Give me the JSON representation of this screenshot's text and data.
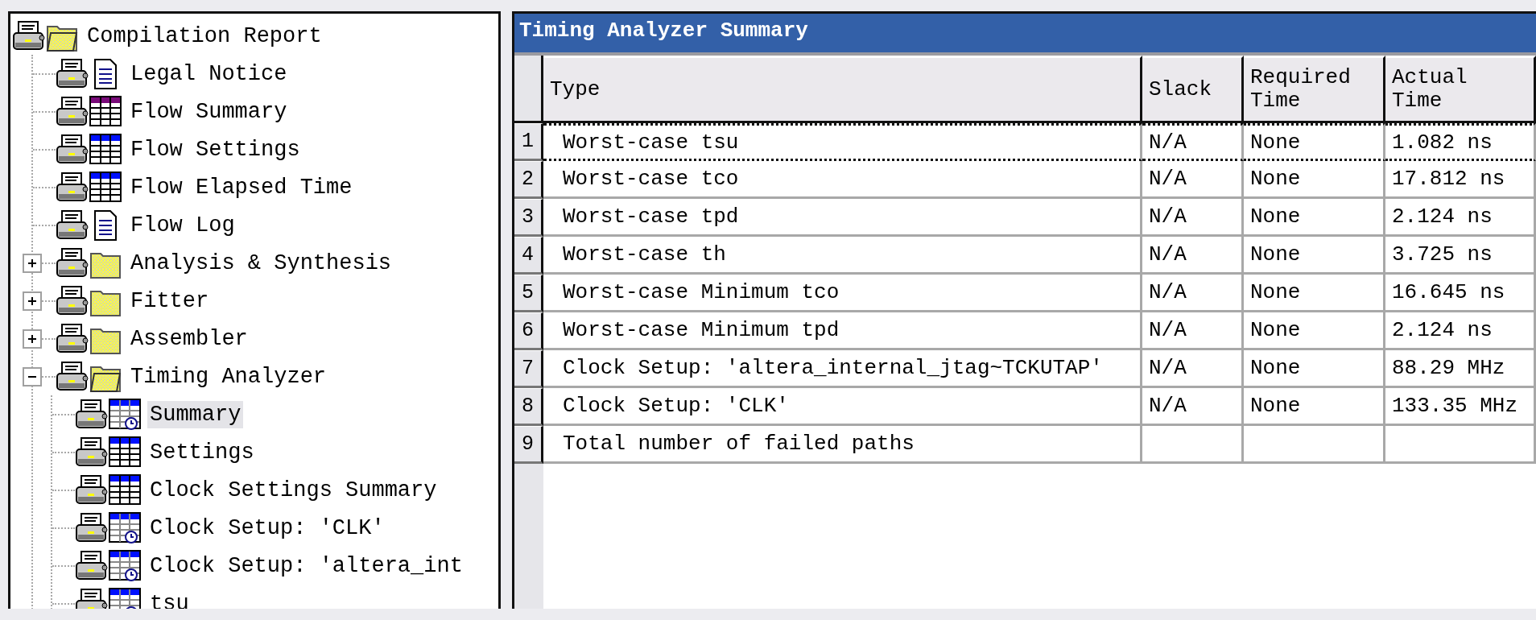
{
  "tree": [
    {
      "label": "Compilation Report",
      "kind": "folder-open",
      "selected": false,
      "children": [
        {
          "label": "Legal Notice",
          "kind": "document",
          "selected": false
        },
        {
          "label": "Flow Summary",
          "kind": "summary",
          "selected": false
        },
        {
          "label": "Flow Settings",
          "kind": "table",
          "selected": false
        },
        {
          "label": "Flow Elapsed Time",
          "kind": "table",
          "selected": false
        },
        {
          "label": "Flow Log",
          "kind": "document",
          "selected": false
        },
        {
          "label": "Analysis & Synthesis",
          "kind": "folder",
          "selected": false,
          "expanded": false
        },
        {
          "label": "Fitter",
          "kind": "folder",
          "selected": false,
          "expanded": false
        },
        {
          "label": "Assembler",
          "kind": "folder",
          "selected": false,
          "expanded": false
        },
        {
          "label": "Timing Analyzer",
          "kind": "folder-open",
          "selected": false,
          "expanded": true,
          "children": [
            {
              "label": "Summary",
              "kind": "timing",
              "selected": true
            },
            {
              "label": "Settings",
              "kind": "table",
              "selected": false
            },
            {
              "label": "Clock Settings Summary",
              "kind": "table",
              "selected": false
            },
            {
              "label": "Clock Setup: 'CLK'",
              "kind": "timing",
              "selected": false
            },
            {
              "label": "Clock Setup: 'altera_int",
              "kind": "timing",
              "selected": false
            },
            {
              "label": "tsu",
              "kind": "timing",
              "selected": false
            }
          ]
        }
      ]
    }
  ],
  "report": {
    "title": "Timing Analyzer Summary",
    "columns": [
      "Type",
      "Slack",
      "Required Time",
      "Actual Time"
    ],
    "rows": [
      {
        "number": "1",
        "selected": true,
        "cells": [
          "Worst-case tsu",
          "N/A",
          "None",
          "1.082 ns"
        ]
      },
      {
        "number": "2",
        "selected": false,
        "cells": [
          "Worst-case tco",
          "N/A",
          "None",
          "17.812 ns"
        ]
      },
      {
        "number": "3",
        "selected": false,
        "cells": [
          "Worst-case tpd",
          "N/A",
          "None",
          "2.124 ns"
        ]
      },
      {
        "number": "4",
        "selected": false,
        "cells": [
          "Worst-case th",
          "N/A",
          "None",
          "3.725 ns"
        ]
      },
      {
        "number": "5",
        "selected": false,
        "cells": [
          "Worst-case Minimum tco",
          "N/A",
          "None",
          "16.645 ns"
        ]
      },
      {
        "number": "6",
        "selected": false,
        "cells": [
          "Worst-case Minimum tpd",
          "N/A",
          "None",
          "2.124 ns"
        ]
      },
      {
        "number": "7",
        "selected": false,
        "cells": [
          "Clock Setup: 'altera_internal_jtag~TCKUTAP'",
          "N/A",
          "None",
          "88.29 MHz"
        ]
      },
      {
        "number": "8",
        "selected": false,
        "cells": [
          "Clock Setup: 'CLK'",
          "N/A",
          "None",
          "133.35 MHz"
        ]
      },
      {
        "number": "9",
        "selected": false,
        "cells": [
          "Total number of failed paths"
        ]
      }
    ]
  }
}
